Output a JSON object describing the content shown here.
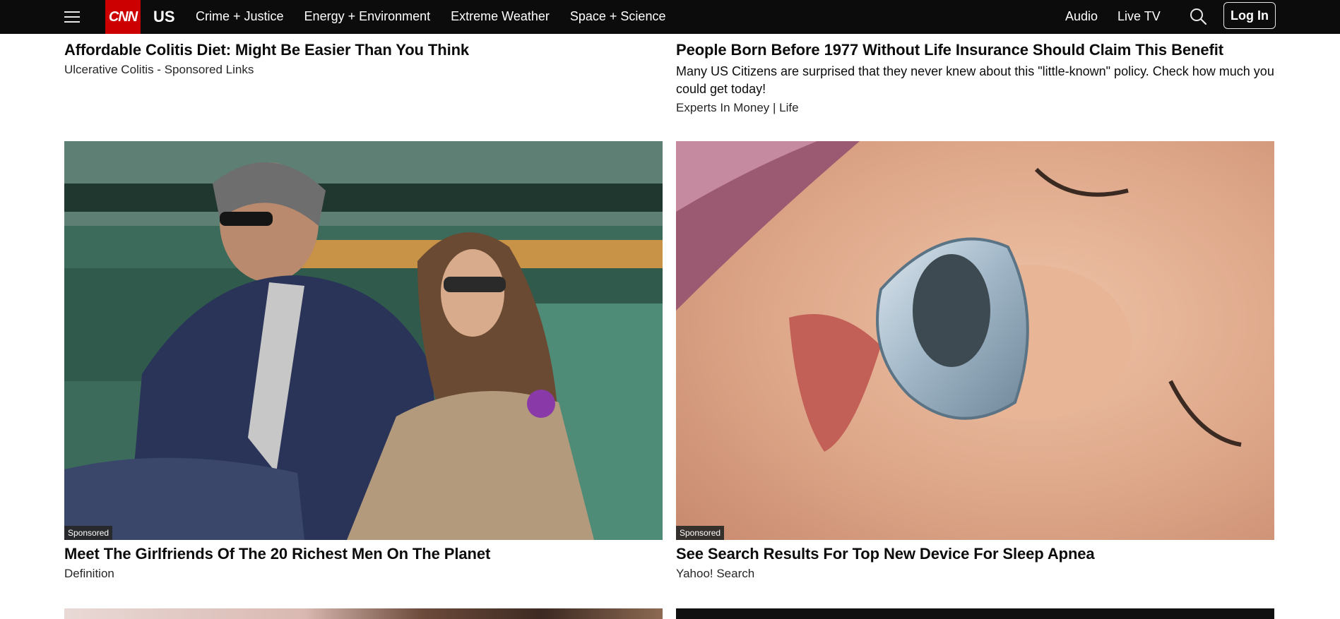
{
  "nav": {
    "logo": "CNN",
    "section": "US",
    "links": [
      "Crime + Justice",
      "Energy + Environment",
      "Extreme Weather",
      "Space + Science"
    ],
    "right_links": [
      "Audio",
      "Live TV"
    ],
    "login_label": "Log In",
    "icons": [
      "menu-icon",
      "search-icon"
    ]
  },
  "cards_top": [
    {
      "headline": "Affordable Colitis Diet: Might Be Easier Than You Think",
      "source": "Ulcerative Colitis - Sponsored Links"
    },
    {
      "headline": "People Born Before 1977 Without Life Insurance Should Claim This Benefit",
      "description": "Many US Citizens are surprised that they never knew about this \"little-known\" policy. Check how much you could get today!",
      "source": "Experts In Money | Life"
    }
  ],
  "cards_main": [
    {
      "badge": "Sponsored",
      "headline": "Meet The Girlfriends Of The 20 Richest Men On The Planet",
      "source": "Definition"
    },
    {
      "badge": "Sponsored",
      "headline": "See Search Results For Top New Device For Sleep Apnea",
      "source": "Yahoo! Search"
    }
  ],
  "colors": {
    "nav_bg": "#0c0c0c",
    "brand_red": "#cc0000",
    "text": "#0c0c0c"
  }
}
